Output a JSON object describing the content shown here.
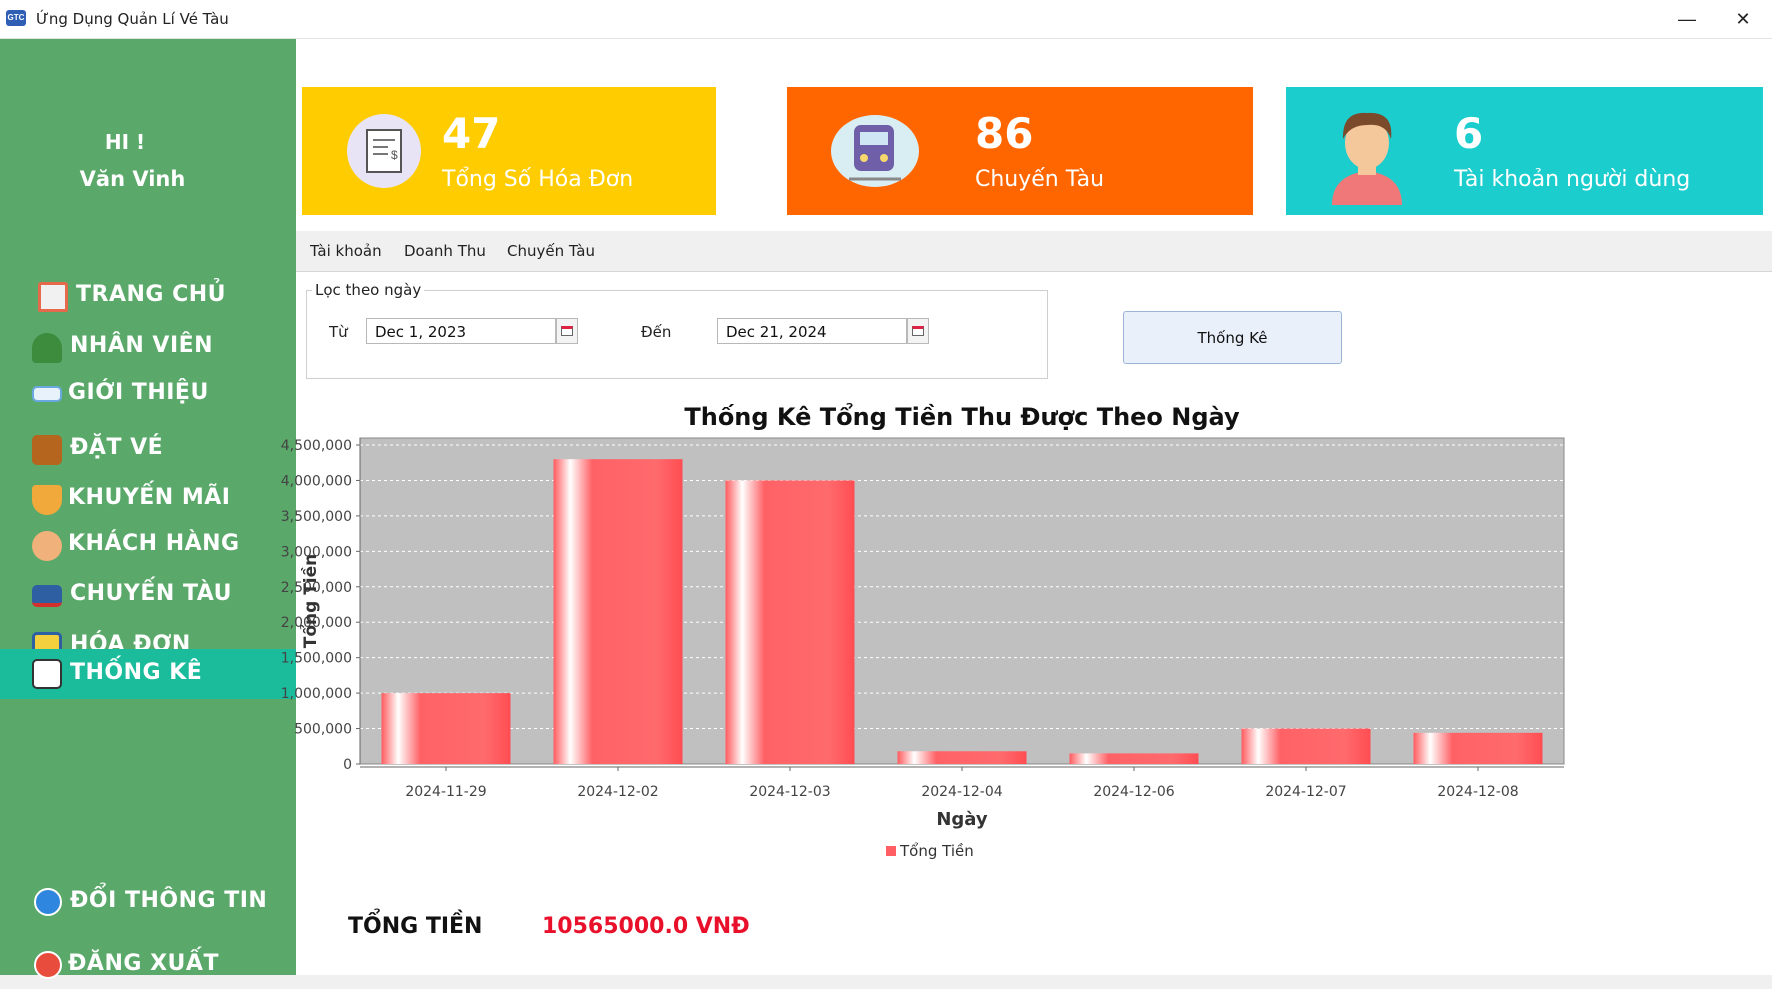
{
  "window": {
    "title": "Ứng Dụng Quản Lí Vé Tàu",
    "min_glyph": "—",
    "close_glyph": "✕",
    "app_icon_text": "GTC"
  },
  "sidebar": {
    "greeting": "HI !",
    "user_name": "Văn Vinh",
    "items": [
      {
        "label": "TRANG CHỦ",
        "icon": "house-icon",
        "color": "#e46a4b"
      },
      {
        "label": "NHÂN VIÊN",
        "icon": "staff-icon",
        "color": "#3d8b3d"
      },
      {
        "label": "GIỚI THIỆU",
        "icon": "id-card-icon",
        "color": "#6aa9e0"
      },
      {
        "label": "ĐẶT VÉ",
        "icon": "ticket-booth-icon",
        "color": "#b5651d"
      },
      {
        "label": "KHUYẾN MÃI",
        "icon": "discount-tag-icon",
        "color": "#f2a93b"
      },
      {
        "label": "KHÁCH HÀNG",
        "icon": "customers-icon",
        "color": "#f0b27a"
      },
      {
        "label": "CHUYẾN TÀU",
        "icon": "train-icon",
        "color": "#2e5fa3"
      },
      {
        "label": "HÓA ĐƠN",
        "icon": "invoice-icon",
        "color": "#f4d03f"
      },
      {
        "label": "THỐNG KÊ",
        "icon": "chart-icon",
        "color": "#ffffff",
        "active": true
      }
    ],
    "bottom_items": [
      {
        "label": "ĐỔI THÔNG TIN",
        "icon": "info-icon",
        "color": "#2e86de"
      },
      {
        "label": "ĐĂNG XUẤT",
        "icon": "power-icon",
        "color": "#e74c3c"
      }
    ]
  },
  "cards": [
    {
      "value": "47",
      "caption": "Tổng Số Hóa Đơn",
      "bg": "#ffcc00",
      "icon": "receipt-icon"
    },
    {
      "value": "86",
      "caption": "Chuyến Tàu",
      "bg": "#ff6600",
      "icon": "train-icon"
    },
    {
      "value": "6",
      "caption": "Tài khoản người dùng",
      "bg": "#1ccdce",
      "icon": "user-avatar-icon"
    }
  ],
  "tabs": [
    {
      "label": "Tài khoản"
    },
    {
      "label": "Doanh Thu",
      "active": true
    },
    {
      "label": "Chuyến Tàu"
    }
  ],
  "filter": {
    "legend": "Lọc theo ngày",
    "from_label": "Từ",
    "from_value": "Dec 1, 2023",
    "to_label": "Đến",
    "to_value": "Dec 21, 2024",
    "button": "Thống Kê"
  },
  "chart_data": {
    "type": "bar",
    "title": "Thống Kê Tổng Tiền Thu Được Theo Ngày",
    "xlabel": "Ngày",
    "ylabel": "Tổng Tiền",
    "categories": [
      "2024-11-29",
      "2024-12-02",
      "2024-12-03",
      "2024-12-04",
      "2024-12-06",
      "2024-12-07",
      "2024-12-08"
    ],
    "series": [
      {
        "name": "Tổng Tiền",
        "values": [
          1000000,
          4300000,
          4000000,
          180000,
          150000,
          500000,
          440000
        ],
        "color": "#ff5f62"
      }
    ],
    "ylim": [
      0,
      4500000
    ],
    "yticks": [
      "0",
      "500,000",
      "1,000,000",
      "1,500,000",
      "2,000,000",
      "2,500,000",
      "3,000,000",
      "3,500,000",
      "4,000,000",
      "4,500,000"
    ],
    "plot_bg": "#c0c0c0",
    "grid": true,
    "legend_position": "bottom"
  },
  "total": {
    "label": "TỔNG TIỀN",
    "value": "10565000.0 VNĐ"
  }
}
